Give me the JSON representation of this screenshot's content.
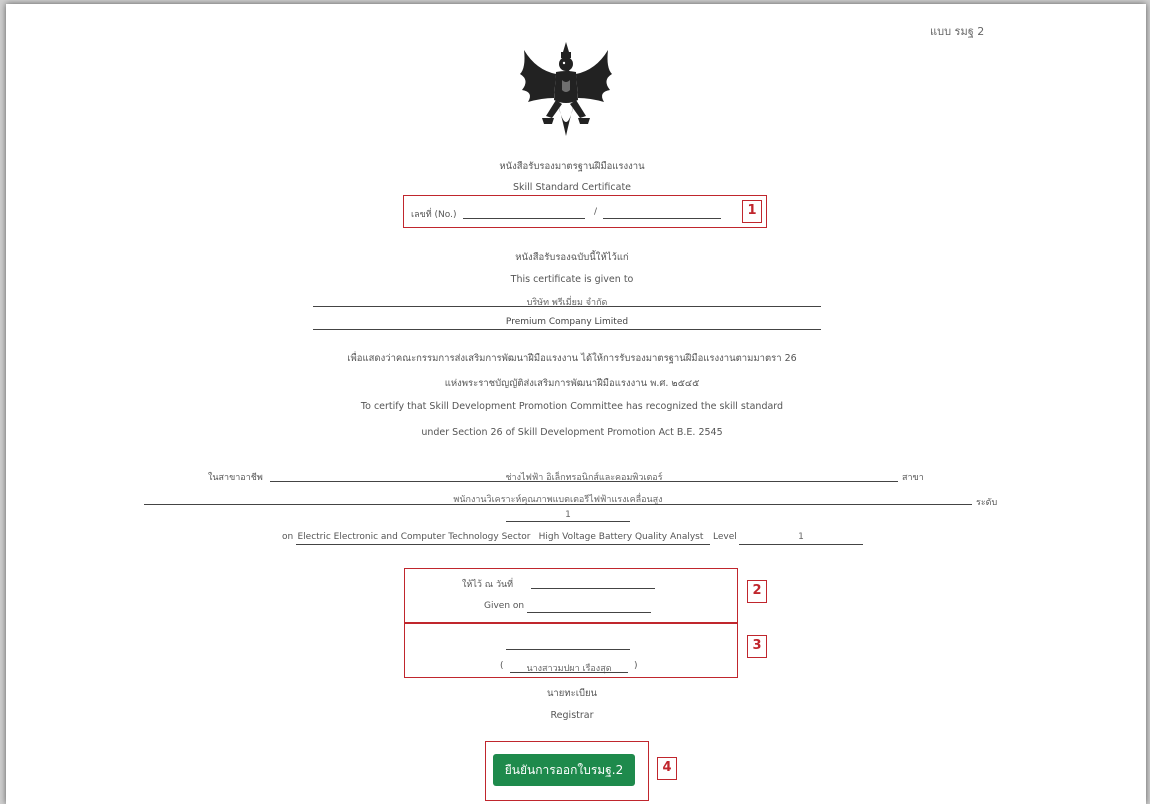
{
  "form_code": "แบบ รมฐ 2",
  "heading_th": "หนังสือรับรองมาตรฐานฝีมือแรงงาน",
  "heading_en": "Skill Standard Certificate",
  "number_label": "เลขที่ (No.)",
  "number_separator": "/",
  "given_to_th": "หนังสือรับรองฉบับนี้ให้ไว้แก่",
  "given_to_en": "This certificate is given to",
  "company_th": "บริษัท พรีเมี่ยม จำกัด",
  "company_en": "Premium Company Limited",
  "certify_th_1": "เพื่อแสดงว่าคณะกรรมการส่งเสริมการพัฒนาฝีมือแรงงาน ได้ให้การรับรองมาตรฐานฝีมือแรงงานตามมาตรา 26",
  "certify_th_2": "แห่งพระราชบัญญัติส่งเสริมการพัฒนาฝีมือแรงงาน พ.ศ. ๒๕๔๕",
  "certify_en_1": "To certify that Skill Development Promotion Committee has recognized the skill standard",
  "certify_en_2": "under Section 26 of Skill Development Promotion Act B.E. 2545",
  "occupation_label_th": "ในสาขาอาชีพ",
  "occupation_value_th": "ช่างไฟฟ้า อิเล็กทรอนิกส์และคอมพิวเตอร์",
  "branch_label_th": "สาขา",
  "branch_value_th": "พนักงานวิเคราะห์คุณภาพแบตเตอรีไฟฟ้าแรงเคลื่อนสูง",
  "level_label_th": "ระดับ",
  "level_value_th": "1",
  "on_label": "on",
  "sector_en": "Electric Electronic and Computer Technology Sector",
  "branch_en": "High Voltage Battery Quality Analyst",
  "level_label_en": "Level",
  "level_value_en": "1",
  "given_on_th": "ให้ไว้ ณ วันที่",
  "given_on_en": "Given on",
  "signer_open": "(",
  "signer_name": "นางสาวมปผา เรืองสุด",
  "signer_close": ")",
  "registrar_th": "นายทะเบียน",
  "registrar_en": "Registrar",
  "confirm_button": "ยืนยันการออกใบรมฐ.2",
  "badges": [
    "1",
    "2",
    "3",
    "4"
  ],
  "colors": {
    "annotation_red": "#c0262d",
    "button_green": "#1e8a4c"
  }
}
